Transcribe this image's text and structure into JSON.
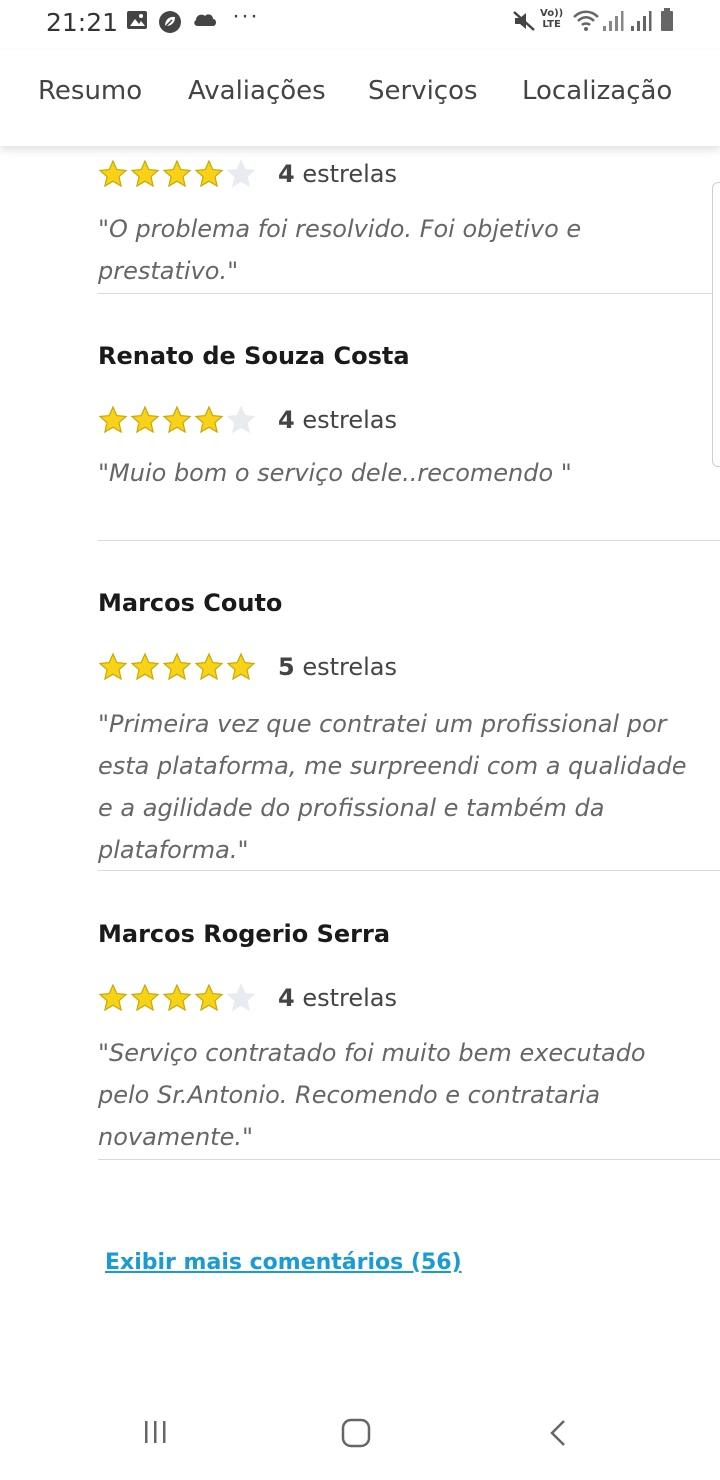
{
  "status_bar": {
    "time": "21:21",
    "icons": [
      "image-icon",
      "leaf-icon",
      "cloud-icon",
      "more-dots-icon",
      "mute-icon",
      "volte-icon",
      "wifi-icon",
      "signal-icon",
      "signal-icon",
      "battery-icon"
    ],
    "more": "···",
    "volte_line1": "Vo))",
    "volte_line2": "LTE"
  },
  "tabs": [
    {
      "label": "Resumo"
    },
    {
      "label": "Avaliações"
    },
    {
      "label": "Serviços"
    },
    {
      "label": "Localização"
    }
  ],
  "reviews": [
    {
      "name": "",
      "stars": 4,
      "rating_num": "4",
      "rating_word": "estrelas",
      "comment": "\"O problema foi resolvido. Foi objetivo e prestativo.\""
    },
    {
      "name": "Renato de Souza Costa",
      "stars": 4,
      "rating_num": "4",
      "rating_word": "estrelas",
      "comment": "\"Muio bom o serviço dele..recomendo \""
    },
    {
      "name": "Marcos Couto",
      "stars": 5,
      "rating_num": "5",
      "rating_word": "estrelas",
      "comment": "\"Primeira vez que contratei um profissional por esta plataforma, me surpreendi com a qualidade e a agilidade do profissional e também da plataforma.\""
    },
    {
      "name": "Marcos Rogerio Serra",
      "stars": 4,
      "rating_num": "4",
      "rating_word": "estrelas",
      "comment": "\"Serviço contratado foi muito bem executado pelo Sr.Antonio. Recomendo e contrataria novamente.\""
    }
  ],
  "more_comments": "Exibir mais comentários (56)",
  "colors": {
    "star_filled": "#f7d217",
    "star_outline": "#c9a800",
    "star_empty": "#e8ebef",
    "link": "#1a9ad6"
  },
  "bottom_nav": {
    "recents": "recents-icon",
    "home": "home-icon",
    "back": "back-icon"
  }
}
